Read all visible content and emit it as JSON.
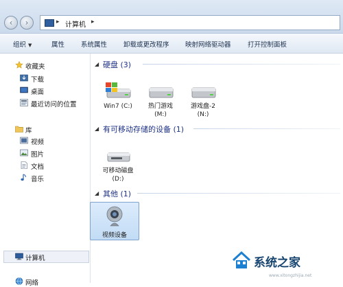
{
  "address": {
    "location": "计算机",
    "back_icon": "back-arrow-icon",
    "forward_icon": "forward-arrow-icon"
  },
  "toolbar": {
    "organize": "组织",
    "properties": "属性",
    "system_properties": "系统属性",
    "uninstall": "卸载或更改程序",
    "map_drive": "映射网络驱动器",
    "control_panel": "打开控制面板"
  },
  "nav": {
    "favorites": "收藏夹",
    "downloads": "下载",
    "desktop": "桌面",
    "recent": "最近访问的位置",
    "libraries": "库",
    "videos": "视频",
    "pictures": "图片",
    "documents": "文档",
    "music": "音乐",
    "computer": "计算机",
    "network": "网络"
  },
  "groups": {
    "hdd": {
      "title": "硬盘 (3)",
      "items": [
        {
          "name": "Win7 (C:)"
        },
        {
          "name": "热门游戏",
          "letter": "(M:)"
        },
        {
          "name": "游戏盘-2",
          "letter": "(N:)"
        }
      ]
    },
    "removable": {
      "title": "有可移动存储的设备 (1)",
      "items": [
        {
          "name": "可移动磁盘",
          "letter": "(D:)"
        }
      ]
    },
    "other": {
      "title": "其他 (1)",
      "items": [
        {
          "name": "视频设备"
        }
      ]
    }
  },
  "watermark": {
    "brand": "系统之家",
    "url": "www.xitongzhijia.net"
  }
}
